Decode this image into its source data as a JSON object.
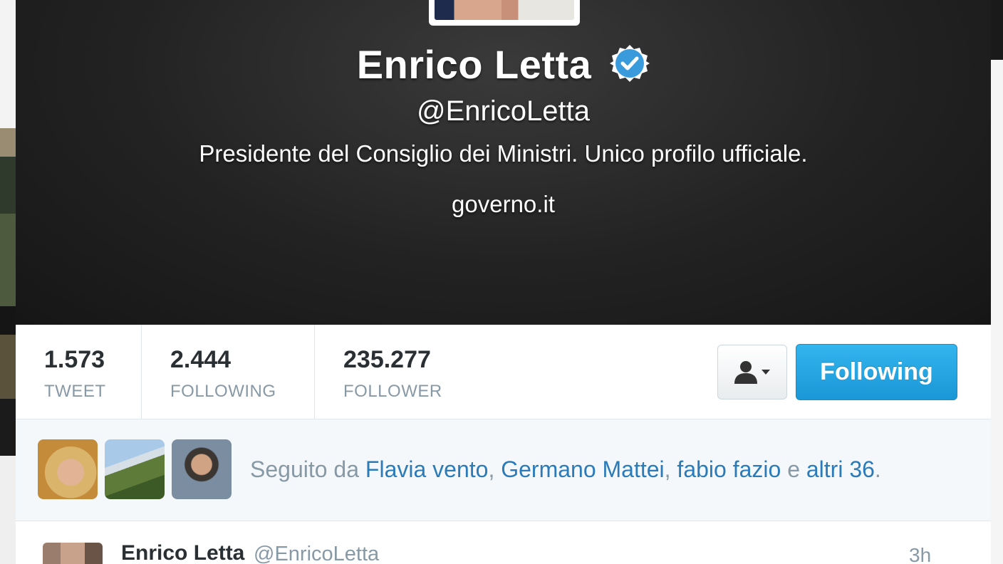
{
  "profile": {
    "name": "Enrico Letta",
    "handle": "@EnricoLetta",
    "bio": "Presidente del Consiglio dei Ministri. Unico profilo ufficiale.",
    "url": "governo.it"
  },
  "stats": [
    {
      "value": "1.573",
      "label": "TWEET"
    },
    {
      "value": "2.444",
      "label": "FOLLOWING"
    },
    {
      "value": "235.277",
      "label": "FOLLOWER"
    }
  ],
  "actions": {
    "follow_label": "Following",
    "user_menu_icon": "user-dropdown-icon"
  },
  "followed_by": {
    "prefix": "Seguito da ",
    "users": [
      "Flavia vento",
      "Germano Mattei",
      "fabio fazio"
    ],
    "sep1": ", ",
    "sep2": ", ",
    "conj": " e ",
    "others": "altri 36",
    "suffix": "."
  },
  "tweet": {
    "name": "Enrico Letta",
    "handle": "@EnricoLetta",
    "time": "3h"
  },
  "colors": {
    "link": "#2b7bb9",
    "follow_button": "#1a97d6",
    "verified_badge": "#3a9bdc"
  }
}
